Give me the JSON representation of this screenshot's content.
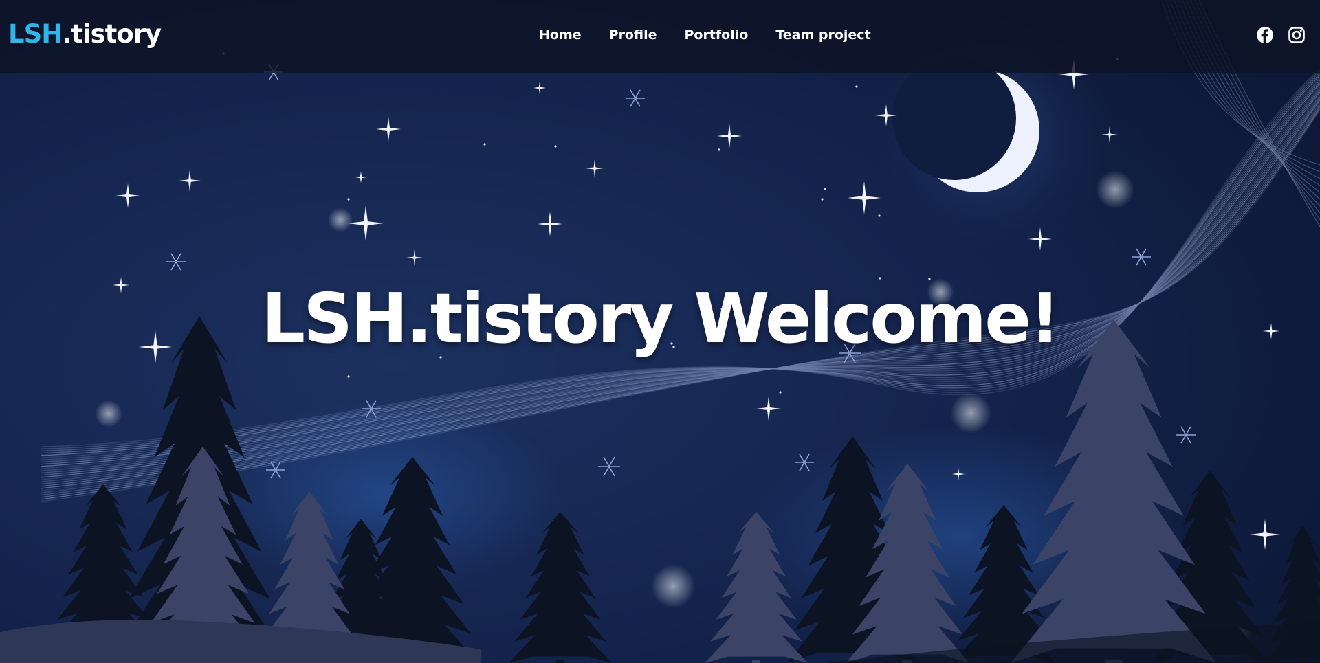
{
  "header": {
    "logo_accent": "LSH",
    "logo_rest": ".tistory",
    "nav": [
      {
        "label": "Home"
      },
      {
        "label": "Profile"
      },
      {
        "label": "Portfolio"
      },
      {
        "label": "Team project"
      }
    ],
    "social": [
      {
        "icon": "facebook-icon"
      },
      {
        "icon": "instagram-icon"
      }
    ]
  },
  "hero": {
    "title": "LSH.tistory Welcome!"
  },
  "colors": {
    "accent": "#2fb4ec",
    "background": "#0f1c38",
    "header_bg": "#0d1426",
    "tree_dark": "#0c1424",
    "tree_light": "#3b4466"
  }
}
